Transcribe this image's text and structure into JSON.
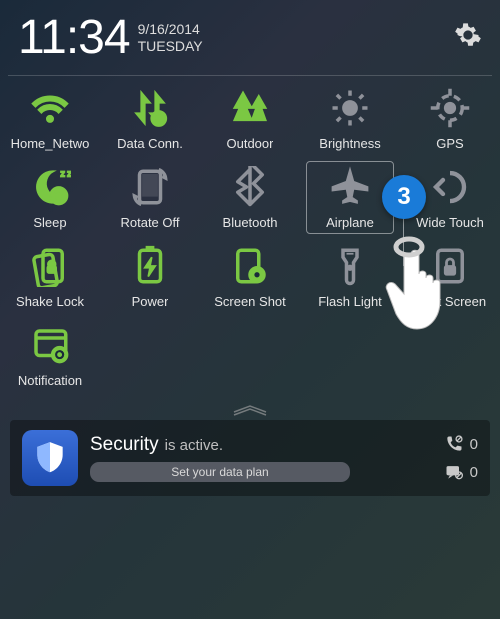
{
  "status": {
    "time": "11:34",
    "date": "9/16/2014",
    "weekday": "TUESDAY"
  },
  "toggles": [
    {
      "id": "wifi",
      "label": "Home_Netwo",
      "active": true,
      "icon": "wifi-icon"
    },
    {
      "id": "data",
      "label": "Data Conn.",
      "active": true,
      "icon": "data-icon"
    },
    {
      "id": "outdoor",
      "label": "Outdoor",
      "active": true,
      "icon": "outdoor-icon"
    },
    {
      "id": "brightness",
      "label": "Brightness",
      "active": false,
      "icon": "brightness-icon"
    },
    {
      "id": "gps",
      "label": "GPS",
      "active": false,
      "icon": "gps-icon"
    },
    {
      "id": "sleep",
      "label": "Sleep",
      "active": true,
      "icon": "sleep-icon"
    },
    {
      "id": "rotate",
      "label": "Rotate Off",
      "active": false,
      "icon": "rotate-icon"
    },
    {
      "id": "bluetooth",
      "label": "Bluetooth",
      "active": false,
      "icon": "bluetooth-icon"
    },
    {
      "id": "airplane",
      "label": "Airplane",
      "active": false,
      "icon": "airplane-icon",
      "highlighted": true
    },
    {
      "id": "widetouch",
      "label": "Wide Touch",
      "active": false,
      "icon": "widetouch-icon"
    },
    {
      "id": "shakelock",
      "label": "Shake Lock",
      "active": true,
      "icon": "shakelock-icon"
    },
    {
      "id": "power",
      "label": "Power",
      "active": true,
      "icon": "power-icon"
    },
    {
      "id": "screenshot",
      "label": "Screen Shot",
      "active": true,
      "icon": "screenshot-icon"
    },
    {
      "id": "flashlight",
      "label": "Flash Light",
      "active": false,
      "icon": "flashlight-icon"
    },
    {
      "id": "lockscreen",
      "label": "Lock Screen",
      "active": false,
      "icon": "lockscreen-icon"
    },
    {
      "id": "notification",
      "label": "Notification",
      "active": true,
      "icon": "notification-icon"
    }
  ],
  "callout": {
    "number": "3"
  },
  "notification": {
    "title": "Security",
    "subtitle": "is active.",
    "button": "Set your data plan",
    "missed_calls": "0",
    "missed_msgs": "0"
  },
  "colors": {
    "active": "#7bc843",
    "inactive": "#8f929a",
    "badge": "#1a7bd8"
  }
}
